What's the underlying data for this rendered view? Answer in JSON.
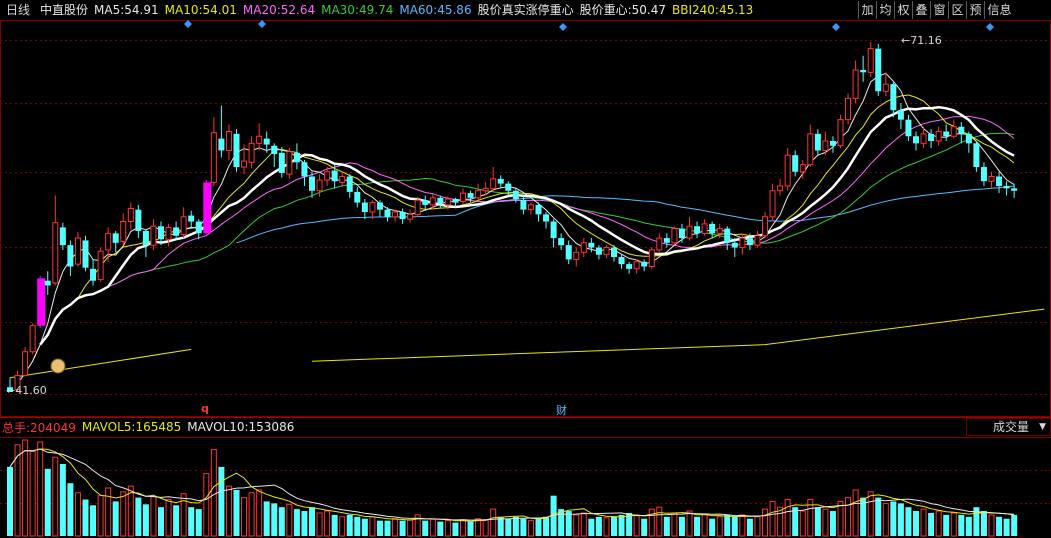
{
  "header": {
    "period": "日线",
    "stock_name": "中直股份",
    "ma5": {
      "label": "MA5:",
      "value": "54.91",
      "color": "#e8e8e8"
    },
    "ma10": {
      "label": "MA10:",
      "value": "54.01",
      "color": "#e8e800"
    },
    "ma20": {
      "label": "MA20:",
      "value": "52.64",
      "color": "#ff66ff"
    },
    "ma30": {
      "label": "MA30:",
      "value": "49.74",
      "color": "#33cc33"
    },
    "ma60": {
      "label": "MA60:",
      "value": "45.86",
      "color": "#55bbff"
    },
    "indicator1": {
      "label": "股价真实涨停重心",
      "color": "#e8e8e8"
    },
    "indicator2": {
      "label": "股价重心:",
      "value": "50.47",
      "color": "#e8e8e8"
    },
    "bbi": {
      "label": "BBI240:",
      "value": "45.13",
      "color": "#e8e800"
    }
  },
  "toolbar": {
    "buttons": [
      "加",
      "均",
      "权",
      "叠",
      "窗",
      "区",
      "预",
      "信息"
    ]
  },
  "price_labels": {
    "high": "71.16",
    "low": "41.60"
  },
  "markers": {
    "q": "q",
    "cai": "财"
  },
  "volume": {
    "total_label": "总手:",
    "total_value": "204049",
    "mavol5_label": "MAVOL5:",
    "mavol5_value": "165485",
    "mavol10_label": "MAVOL10:",
    "mavol10_value": "153086",
    "selector_value": "成交量",
    "total_color": "#ff3333",
    "mavol5_color": "#e8e800",
    "mavol10_color": "#e8e8e8"
  },
  "colors": {
    "up": "#ff3232",
    "down": "#54ffff",
    "limit_up": "#ff00ff",
    "grid": "#800000"
  },
  "chart_data": {
    "type": "candlestick",
    "price_high": 71.16,
    "price_low": 41.6,
    "candles": [
      [
        42.0,
        41.6,
        42.8,
        41.6
      ],
      [
        41.8,
        43.0,
        43.4,
        41.6
      ],
      [
        43.0,
        45.0,
        45.4,
        42.9
      ],
      [
        45.0,
        47.2,
        47.4,
        44.8
      ],
      [
        47.2,
        51.2,
        51.4,
        47.0
      ],
      [
        51.0,
        50.6,
        51.8,
        49.8
      ],
      [
        50.8,
        55.9,
        58.2,
        50.6
      ],
      [
        55.5,
        54.0,
        55.9,
        53.6
      ],
      [
        54.0,
        52.2,
        54.4,
        51.4
      ],
      [
        52.4,
        54.6,
        55.1,
        52.2
      ],
      [
        54.4,
        52.1,
        54.8,
        51.8
      ],
      [
        52.0,
        51.0,
        52.8,
        50.6
      ],
      [
        51.1,
        53.5,
        53.8,
        50.9
      ],
      [
        53.6,
        55.0,
        55.5,
        52.6
      ],
      [
        55.0,
        54.2,
        55.2,
        53.4
      ],
      [
        54.3,
        56.0,
        56.7,
        54.0
      ],
      [
        56.0,
        57.1,
        57.6,
        55.3
      ],
      [
        57.0,
        55.2,
        57.4,
        54.6
      ],
      [
        55.2,
        54.0,
        55.3,
        53.0
      ],
      [
        54.0,
        55.6,
        56.2,
        53.6
      ],
      [
        55.6,
        54.5,
        56.0,
        54.0
      ],
      [
        54.5,
        55.5,
        55.8,
        53.9
      ],
      [
        55.5,
        54.8,
        56.0,
        54.4
      ],
      [
        54.9,
        56.4,
        57.2,
        54.6
      ],
      [
        56.5,
        56.0,
        56.9,
        55.4
      ],
      [
        56.0,
        55.0,
        56.2,
        54.5
      ],
      [
        55.0,
        59.3,
        59.5,
        55.0
      ],
      [
        59.3,
        63.5,
        64.8,
        59.0
      ],
      [
        63.0,
        62.0,
        65.8,
        61.4
      ],
      [
        62.0,
        63.6,
        64.2,
        61.2
      ],
      [
        63.4,
        60.6,
        63.8,
        60.2
      ],
      [
        60.6,
        61.1,
        62.5,
        60.0
      ],
      [
        61.0,
        62.6,
        63.2,
        60.5
      ],
      [
        62.6,
        63.2,
        64.3,
        62.0
      ],
      [
        63.0,
        62.5,
        63.6,
        61.8
      ],
      [
        62.4,
        61.7,
        62.6,
        60.6
      ],
      [
        61.8,
        60.1,
        62.3,
        59.7
      ],
      [
        60.0,
        61.9,
        62.2,
        59.6
      ],
      [
        61.8,
        61.0,
        62.6,
        60.4
      ],
      [
        61.0,
        59.8,
        61.2,
        59.0
      ],
      [
        59.8,
        58.6,
        60.2,
        58.0
      ],
      [
        58.6,
        59.5,
        60.0,
        58.1
      ],
      [
        59.5,
        60.2,
        60.6,
        59.0
      ],
      [
        60.3,
        59.4,
        60.8,
        58.8
      ],
      [
        59.3,
        59.8,
        60.2,
        58.9
      ],
      [
        59.8,
        58.5,
        60.0,
        58.0
      ],
      [
        58.5,
        57.6,
        58.9,
        57.2
      ],
      [
        57.6,
        56.8,
        57.9,
        56.2
      ],
      [
        56.8,
        57.6,
        57.8,
        56.2
      ],
      [
        57.6,
        57.0,
        57.8,
        56.4
      ],
      [
        57.0,
        56.4,
        57.2,
        56.0
      ],
      [
        56.4,
        56.8,
        57.0,
        56.0
      ],
      [
        56.8,
        56.2,
        57.1,
        55.8
      ],
      [
        56.2,
        56.6,
        57.0,
        55.9
      ],
      [
        56.6,
        57.8,
        58.1,
        56.4
      ],
      [
        57.8,
        57.4,
        58.2,
        57.0
      ],
      [
        57.4,
        58.0,
        58.3,
        57.0
      ],
      [
        58.0,
        57.5,
        58.2,
        57.1
      ],
      [
        57.4,
        57.9,
        58.1,
        57.0
      ],
      [
        57.9,
        57.6,
        58.0,
        57.2
      ],
      [
        57.7,
        58.4,
        58.8,
        57.4
      ],
      [
        58.4,
        58.0,
        58.6,
        57.6
      ],
      [
        58.0,
        58.6,
        59.2,
        57.8
      ],
      [
        58.6,
        58.8,
        59.3,
        58.2
      ],
      [
        58.8,
        59.6,
        60.6,
        58.5
      ],
      [
        59.6,
        59.2,
        59.9,
        58.8
      ],
      [
        59.2,
        58.6,
        59.4,
        58.2
      ],
      [
        58.6,
        57.9,
        58.8,
        57.6
      ],
      [
        57.8,
        57.0,
        58.2,
        56.6
      ],
      [
        57.0,
        57.4,
        57.6,
        56.6
      ],
      [
        57.4,
        56.6,
        57.6,
        56.0
      ],
      [
        56.6,
        56.0,
        56.8,
        55.4
      ],
      [
        56.0,
        54.6,
        56.2,
        53.8
      ],
      [
        54.6,
        54.0,
        55.0,
        53.6
      ],
      [
        54.0,
        52.8,
        54.4,
        52.4
      ],
      [
        52.8,
        53.4,
        53.8,
        52.2
      ],
      [
        53.4,
        54.2,
        54.6,
        53.0
      ],
      [
        54.2,
        53.8,
        54.6,
        53.4
      ],
      [
        53.8,
        53.2,
        54.0,
        52.8
      ],
      [
        53.2,
        53.8,
        54.0,
        52.9
      ],
      [
        53.8,
        53.0,
        54.0,
        52.6
      ],
      [
        53.0,
        52.4,
        53.2,
        52.0
      ],
      [
        52.4,
        52.0,
        52.6,
        51.6
      ],
      [
        52.0,
        52.6,
        52.8,
        51.6
      ],
      [
        52.6,
        52.2,
        52.8,
        51.8
      ],
      [
        52.2,
        53.6,
        53.8,
        52.0
      ],
      [
        53.6,
        54.6,
        55.0,
        53.4
      ],
      [
        54.6,
        54.2,
        55.0,
        53.8
      ],
      [
        54.2,
        55.4,
        55.6,
        54.0
      ],
      [
        55.4,
        54.6,
        55.8,
        54.2
      ],
      [
        54.6,
        55.6,
        56.4,
        54.4
      ],
      [
        55.6,
        55.0,
        56.0,
        54.6
      ],
      [
        55.0,
        55.8,
        56.2,
        54.8
      ],
      [
        55.8,
        55.0,
        56.0,
        54.6
      ],
      [
        55.0,
        55.4,
        55.8,
        54.6
      ],
      [
        55.4,
        54.2,
        55.6,
        53.6
      ],
      [
        54.2,
        53.8,
        54.6,
        53.0
      ],
      [
        53.8,
        54.6,
        55.0,
        53.2
      ],
      [
        54.6,
        54.0,
        55.0,
        53.6
      ],
      [
        54.0,
        54.8,
        55.2,
        53.8
      ],
      [
        54.8,
        56.4,
        56.8,
        54.6
      ],
      [
        56.4,
        58.6,
        59.2,
        56.0
      ],
      [
        58.6,
        59.0,
        59.6,
        58.2
      ],
      [
        59.0,
        61.6,
        62.2,
        58.6
      ],
      [
        61.6,
        60.2,
        62.0,
        59.8
      ],
      [
        60.2,
        60.8,
        61.2,
        59.6
      ],
      [
        60.8,
        63.4,
        64.2,
        60.6
      ],
      [
        63.4,
        62.0,
        63.8,
        61.6
      ],
      [
        62.0,
        62.8,
        63.6,
        61.6
      ],
      [
        62.8,
        62.4,
        63.2,
        61.8
      ],
      [
        62.4,
        64.6,
        65.0,
        62.2
      ],
      [
        64.6,
        66.4,
        66.8,
        64.2
      ],
      [
        66.4,
        68.8,
        69.6,
        66.0
      ],
      [
        68.8,
        68.6,
        70.0,
        67.8
      ],
      [
        68.6,
        70.6,
        71.16,
        68.2
      ],
      [
        70.6,
        67.0,
        71.0,
        66.6
      ],
      [
        67.0,
        67.6,
        68.6,
        66.6
      ],
      [
        67.6,
        65.4,
        67.8,
        64.8
      ],
      [
        65.4,
        64.6,
        66.0,
        63.8
      ],
      [
        64.6,
        63.2,
        65.0,
        62.8
      ],
      [
        63.2,
        62.6,
        63.6,
        62.0
      ],
      [
        62.6,
        63.4,
        64.0,
        62.2
      ],
      [
        63.4,
        62.8,
        63.8,
        62.2
      ],
      [
        62.8,
        63.6,
        64.0,
        62.4
      ],
      [
        63.6,
        63.2,
        64.2,
        62.8
      ],
      [
        63.2,
        64.0,
        64.6,
        63.0
      ],
      [
        64.0,
        63.4,
        64.4,
        62.6
      ],
      [
        63.4,
        62.6,
        63.6,
        61.8
      ],
      [
        62.6,
        60.6,
        62.8,
        60.2
      ],
      [
        60.6,
        59.4,
        61.0,
        59.0
      ],
      [
        59.4,
        59.8,
        60.2,
        58.8
      ],
      [
        59.8,
        59.0,
        60.2,
        58.4
      ],
      [
        59.0,
        58.8,
        59.4,
        58.2
      ],
      [
        58.8,
        58.6,
        59.2,
        58.0
      ]
    ],
    "volumes": [
      [
        0.72,
        0
      ],
      [
        0.95,
        1
      ],
      [
        1.0,
        1
      ],
      [
        0.88,
        1
      ],
      [
        0.98,
        1
      ],
      [
        0.7,
        0
      ],
      [
        0.82,
        1
      ],
      [
        0.75,
        0
      ],
      [
        0.55,
        0
      ],
      [
        0.45,
        1
      ],
      [
        0.38,
        0
      ],
      [
        0.32,
        0
      ],
      [
        0.42,
        1
      ],
      [
        0.5,
        1
      ],
      [
        0.36,
        0
      ],
      [
        0.46,
        1
      ],
      [
        0.52,
        1
      ],
      [
        0.4,
        0
      ],
      [
        0.33,
        0
      ],
      [
        0.41,
        1
      ],
      [
        0.3,
        0
      ],
      [
        0.38,
        1
      ],
      [
        0.32,
        0
      ],
      [
        0.44,
        1
      ],
      [
        0.3,
        0
      ],
      [
        0.28,
        0
      ],
      [
        0.65,
        1
      ],
      [
        0.9,
        1
      ],
      [
        0.72,
        0
      ],
      [
        0.52,
        1
      ],
      [
        0.48,
        0
      ],
      [
        0.4,
        1
      ],
      [
        0.45,
        1
      ],
      [
        0.48,
        1
      ],
      [
        0.36,
        0
      ],
      [
        0.34,
        0
      ],
      [
        0.3,
        0
      ],
      [
        0.33,
        1
      ],
      [
        0.28,
        0
      ],
      [
        0.26,
        0
      ],
      [
        0.3,
        0
      ],
      [
        0.24,
        1
      ],
      [
        0.26,
        1
      ],
      [
        0.22,
        0
      ],
      [
        0.2,
        1
      ],
      [
        0.22,
        0
      ],
      [
        0.2,
        0
      ],
      [
        0.18,
        0
      ],
      [
        0.2,
        1
      ],
      [
        0.16,
        0
      ],
      [
        0.16,
        0
      ],
      [
        0.18,
        1
      ],
      [
        0.16,
        0
      ],
      [
        0.17,
        1
      ],
      [
        0.22,
        1
      ],
      [
        0.16,
        0
      ],
      [
        0.18,
        1
      ],
      [
        0.15,
        0
      ],
      [
        0.16,
        1
      ],
      [
        0.14,
        0
      ],
      [
        0.17,
        1
      ],
      [
        0.15,
        0
      ],
      [
        0.18,
        1
      ],
      [
        0.17,
        1
      ],
      [
        0.28,
        1
      ],
      [
        0.2,
        0
      ],
      [
        0.18,
        0
      ],
      [
        0.2,
        0
      ],
      [
        0.18,
        0
      ],
      [
        0.16,
        1
      ],
      [
        0.18,
        0
      ],
      [
        0.2,
        0
      ],
      [
        0.42,
        0
      ],
      [
        0.28,
        0
      ],
      [
        0.26,
        0
      ],
      [
        0.22,
        1
      ],
      [
        0.24,
        1
      ],
      [
        0.18,
        0
      ],
      [
        0.2,
        0
      ],
      [
        0.19,
        1
      ],
      [
        0.2,
        0
      ],
      [
        0.22,
        0
      ],
      [
        0.24,
        0
      ],
      [
        0.22,
        1
      ],
      [
        0.18,
        0
      ],
      [
        0.28,
        1
      ],
      [
        0.3,
        1
      ],
      [
        0.2,
        0
      ],
      [
        0.24,
        1
      ],
      [
        0.2,
        0
      ],
      [
        0.26,
        1
      ],
      [
        0.2,
        0
      ],
      [
        0.22,
        1
      ],
      [
        0.18,
        0
      ],
      [
        0.2,
        1
      ],
      [
        0.22,
        0
      ],
      [
        0.2,
        0
      ],
      [
        0.22,
        1
      ],
      [
        0.18,
        0
      ],
      [
        0.2,
        1
      ],
      [
        0.28,
        1
      ],
      [
        0.36,
        1
      ],
      [
        0.3,
        1
      ],
      [
        0.38,
        1
      ],
      [
        0.3,
        0
      ],
      [
        0.26,
        1
      ],
      [
        0.38,
        1
      ],
      [
        0.3,
        0
      ],
      [
        0.28,
        1
      ],
      [
        0.26,
        0
      ],
      [
        0.36,
        1
      ],
      [
        0.4,
        1
      ],
      [
        0.48,
        1
      ],
      [
        0.4,
        0
      ],
      [
        0.46,
        1
      ],
      [
        0.4,
        0
      ],
      [
        0.34,
        1
      ],
      [
        0.36,
        0
      ],
      [
        0.34,
        0
      ],
      [
        0.3,
        0
      ],
      [
        0.26,
        0
      ],
      [
        0.28,
        1
      ],
      [
        0.24,
        0
      ],
      [
        0.26,
        1
      ],
      [
        0.22,
        0
      ],
      [
        0.24,
        1
      ],
      [
        0.22,
        0
      ],
      [
        0.2,
        0
      ],
      [
        0.3,
        0
      ],
      [
        0.26,
        0
      ],
      [
        0.22,
        1
      ],
      [
        0.2,
        0
      ],
      [
        0.18,
        0
      ],
      [
        0.22,
        0
      ]
    ],
    "limit_up_indices": [
      4,
      26
    ]
  }
}
